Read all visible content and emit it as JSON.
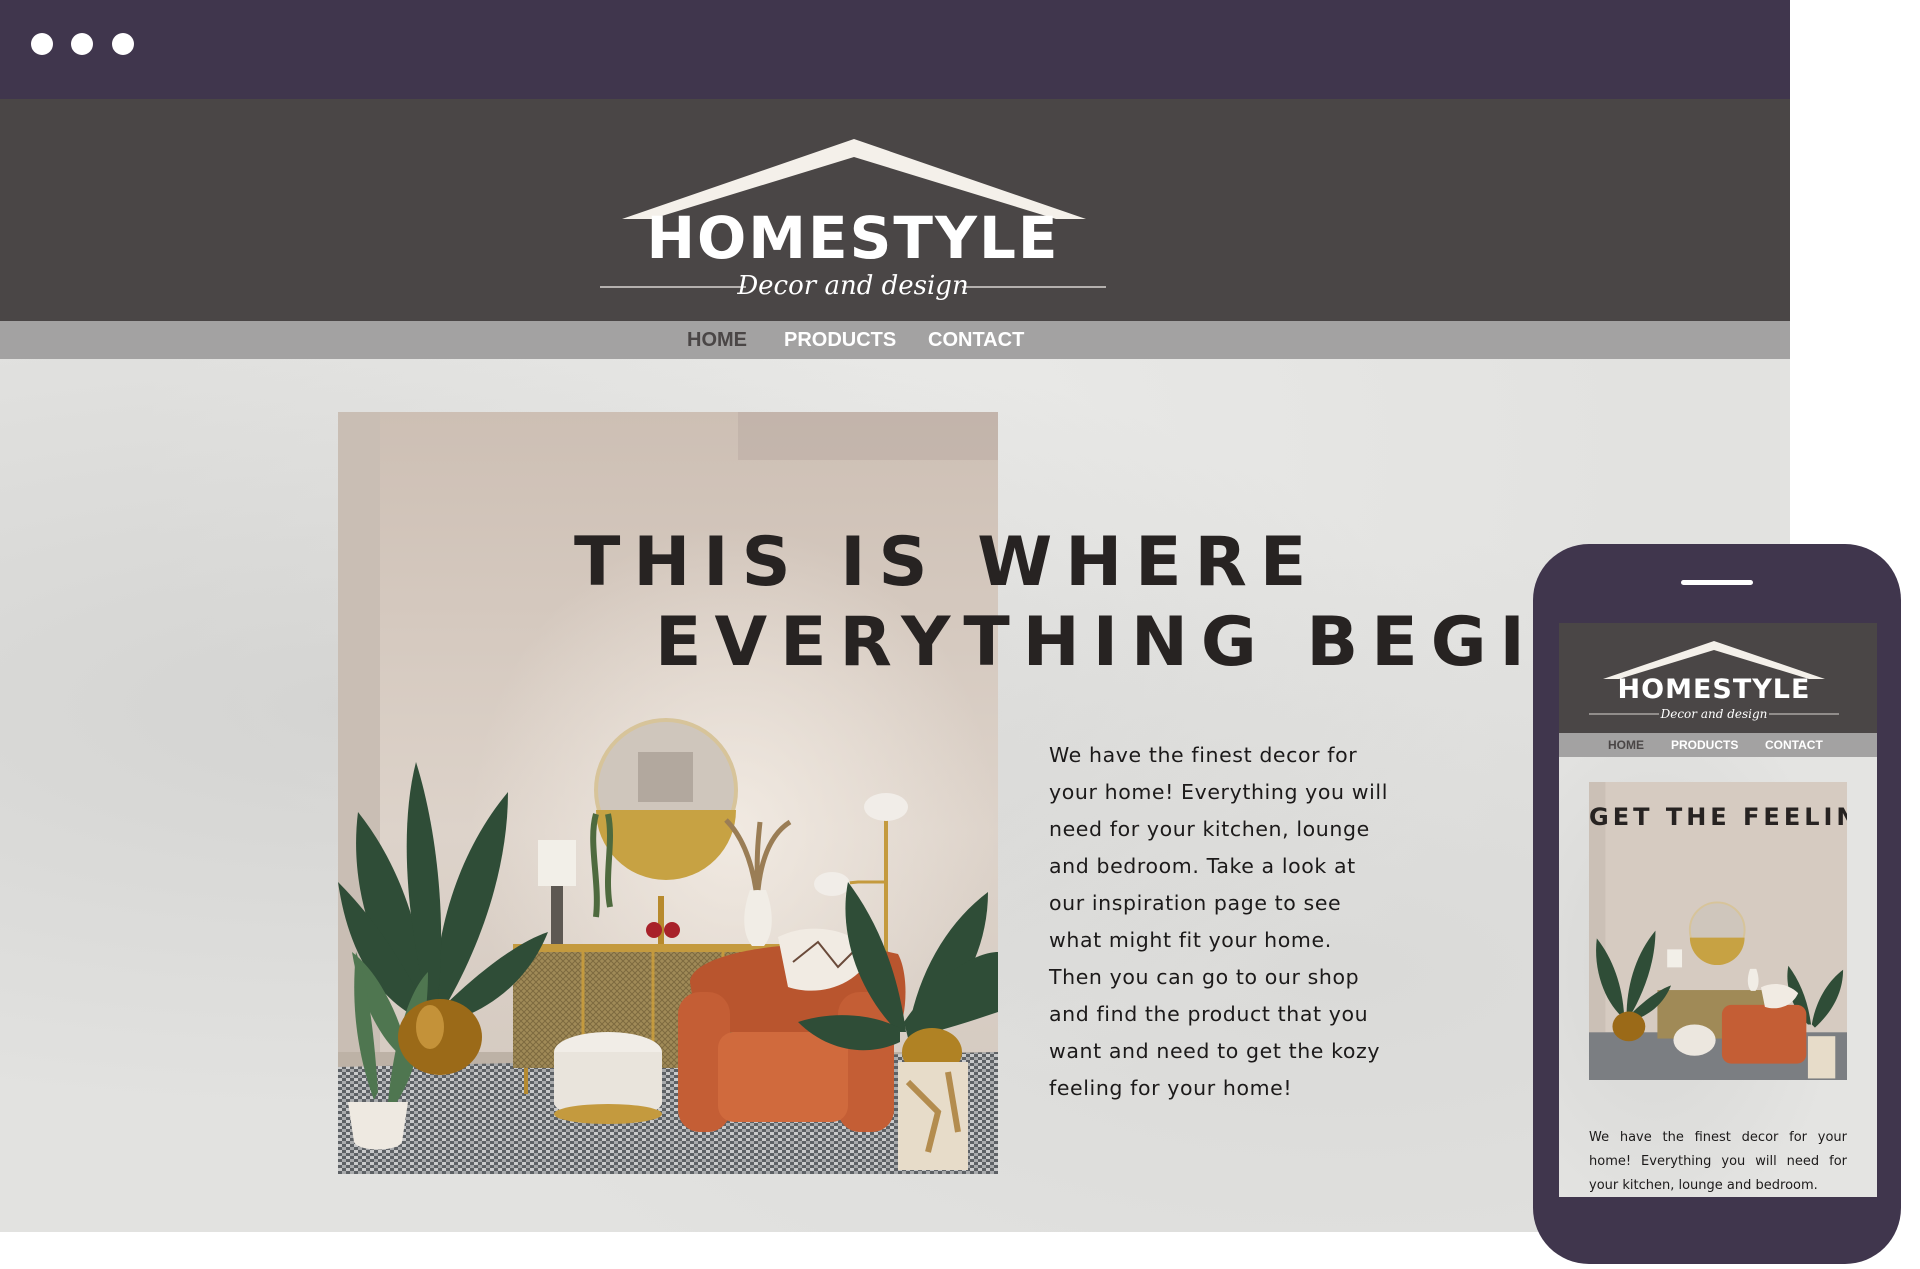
{
  "browser": {
    "window_dots": [
      "dot",
      "dot",
      "dot"
    ]
  },
  "site": {
    "logo": {
      "name": "HOMESTYLE",
      "tagline": "Decor and design"
    },
    "nav": [
      {
        "label": "HOME",
        "active": true
      },
      {
        "label": "PRODUCTS",
        "active": false
      },
      {
        "label": "CONTACT",
        "active": false
      }
    ],
    "hero": {
      "headline_line1": "THIS IS WHERE",
      "headline_line2": "EVERYTHING BEGINS",
      "intro": "We have the finest decor for your home! Everything you will need for your kitchen, lounge and bedroom. Take a look at our inspiration page to see what might fit your home. Then you can go to our shop and find the product that you want and need to get the kozy feeling for your home!"
    }
  },
  "mobile": {
    "logo": {
      "name": "HOMESTYLE",
      "tagline": "Decor and design"
    },
    "nav": [
      {
        "label": "HOME",
        "active": true
      },
      {
        "label": "PRODUCTS",
        "active": false
      },
      {
        "label": "CONTACT",
        "active": false
      }
    ],
    "headline": "GET THE FEELING",
    "intro": "We have the finest decor for your home! Everything you will need for your kitchen, lounge and bedroom."
  },
  "colors": {
    "frame": "#40364d",
    "header": "#4a4646",
    "nav_bar": "#a3a2a2",
    "nav_active": "#4a4646",
    "nav_text": "#ffffff",
    "headline": "#272322",
    "chair": "#c45e35"
  }
}
